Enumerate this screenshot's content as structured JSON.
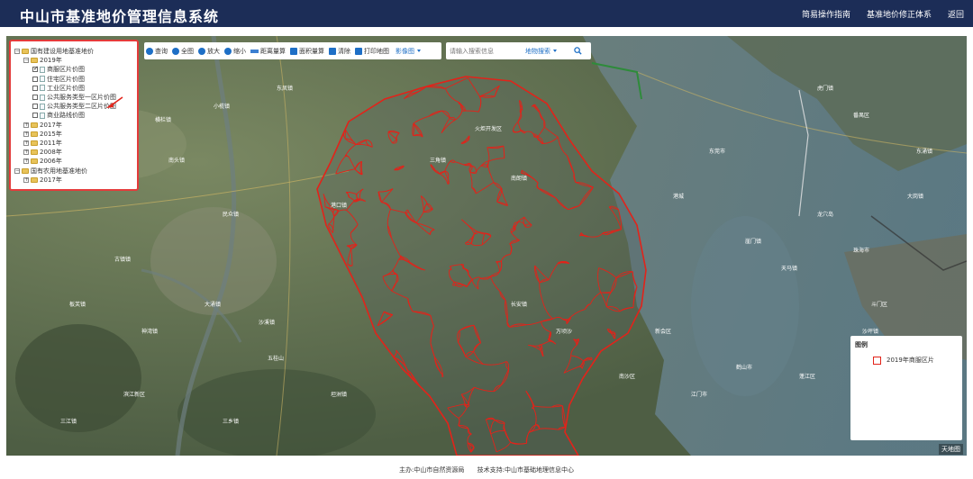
{
  "header": {
    "title": "中山市基准地价管理信息系统",
    "nav": [
      "简易操作指南",
      "基准地价修正体系",
      "返回"
    ]
  },
  "tree": {
    "root1": "国有建设用地基准地价",
    "year2019": "2019年",
    "layers": [
      "商服区片价图",
      "住宅区片价图",
      "工业区片价图",
      "公共服务类型一区片价图",
      "公共服务类型二区片价图",
      "商业路线价图"
    ],
    "layers_checked": [
      true,
      false,
      false,
      false,
      false,
      false
    ],
    "other_years": [
      "2017年",
      "2015年",
      "2011年",
      "2008年",
      "2006年"
    ],
    "root2": "国有农用地基准地价",
    "root2_year": "2017年"
  },
  "toolbar": {
    "items": [
      "查询",
      "全图",
      "放大",
      "缩小",
      "距离量算",
      "面积量算",
      "清除",
      "打印地图"
    ],
    "map_type": "影像图"
  },
  "search": {
    "placeholder": "请输入搜索信息",
    "type": "地物搜索"
  },
  "legend": {
    "title": "图例",
    "item": "2019年商服区片"
  },
  "map": {
    "watermark": "天地图",
    "parcel_color": "#e2231a",
    "place_labels": [
      "横栏镇",
      "小榄镇",
      "东凤镇",
      "南头镇",
      "黄圃镇",
      "民众镇",
      "港口镇",
      "火炬开发区",
      "三角镇",
      "南朗镇",
      "古镇镇",
      "神湾镇",
      "板芙镇",
      "大涌镇",
      "沙溪镇",
      "五桂山",
      "坦洲镇",
      "三乡镇",
      "长安镇",
      "万顷沙",
      "南沙区",
      "新会区",
      "江门市",
      "鹤山市",
      "蓬江区",
      "龙穴岛",
      "珠海市",
      "斗门区",
      "大岗镇",
      "东涌镇",
      "番禺区",
      "虎门镇",
      "东莞市",
      "港城",
      "崖门镇",
      "天马镇",
      "沙坪镇",
      "双水镇",
      "三江镇",
      "滨江新区"
    ]
  },
  "footer": {
    "host": "主办:中山市自然资源局",
    "support": "技术支持:中山市基础地理信息中心"
  }
}
